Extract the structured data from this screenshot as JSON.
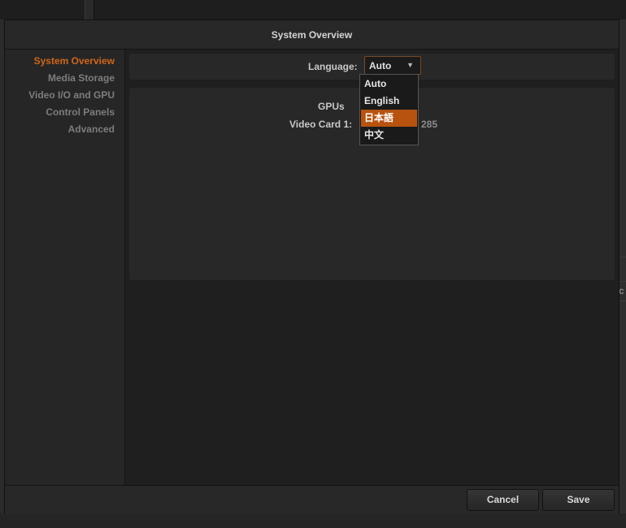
{
  "dialog": {
    "title": "System Overview"
  },
  "sidebar": {
    "items": [
      {
        "label": "System Overview",
        "active": true
      },
      {
        "label": "Media Storage",
        "active": false
      },
      {
        "label": "Video I/O and GPU",
        "active": false
      },
      {
        "label": "Control Panels",
        "active": false
      },
      {
        "label": "Advanced",
        "active": false
      }
    ]
  },
  "language": {
    "label": "Language:",
    "selected": "Auto",
    "options": [
      "Auto",
      "English",
      "日本語",
      "中文"
    ],
    "highlighted": "日本語"
  },
  "gpus": {
    "heading": "GPUs",
    "card_label": "Video Card 1:",
    "card_value_visible": "285"
  },
  "footer": {
    "cancel_label": "Cancel",
    "save_label": "Save"
  },
  "background": {
    "partial_char": "c"
  },
  "colors": {
    "accent": "#d0661a",
    "highlight": "#b8530f",
    "panel": "#282828",
    "dialog_bg": "#1f1f1f"
  }
}
